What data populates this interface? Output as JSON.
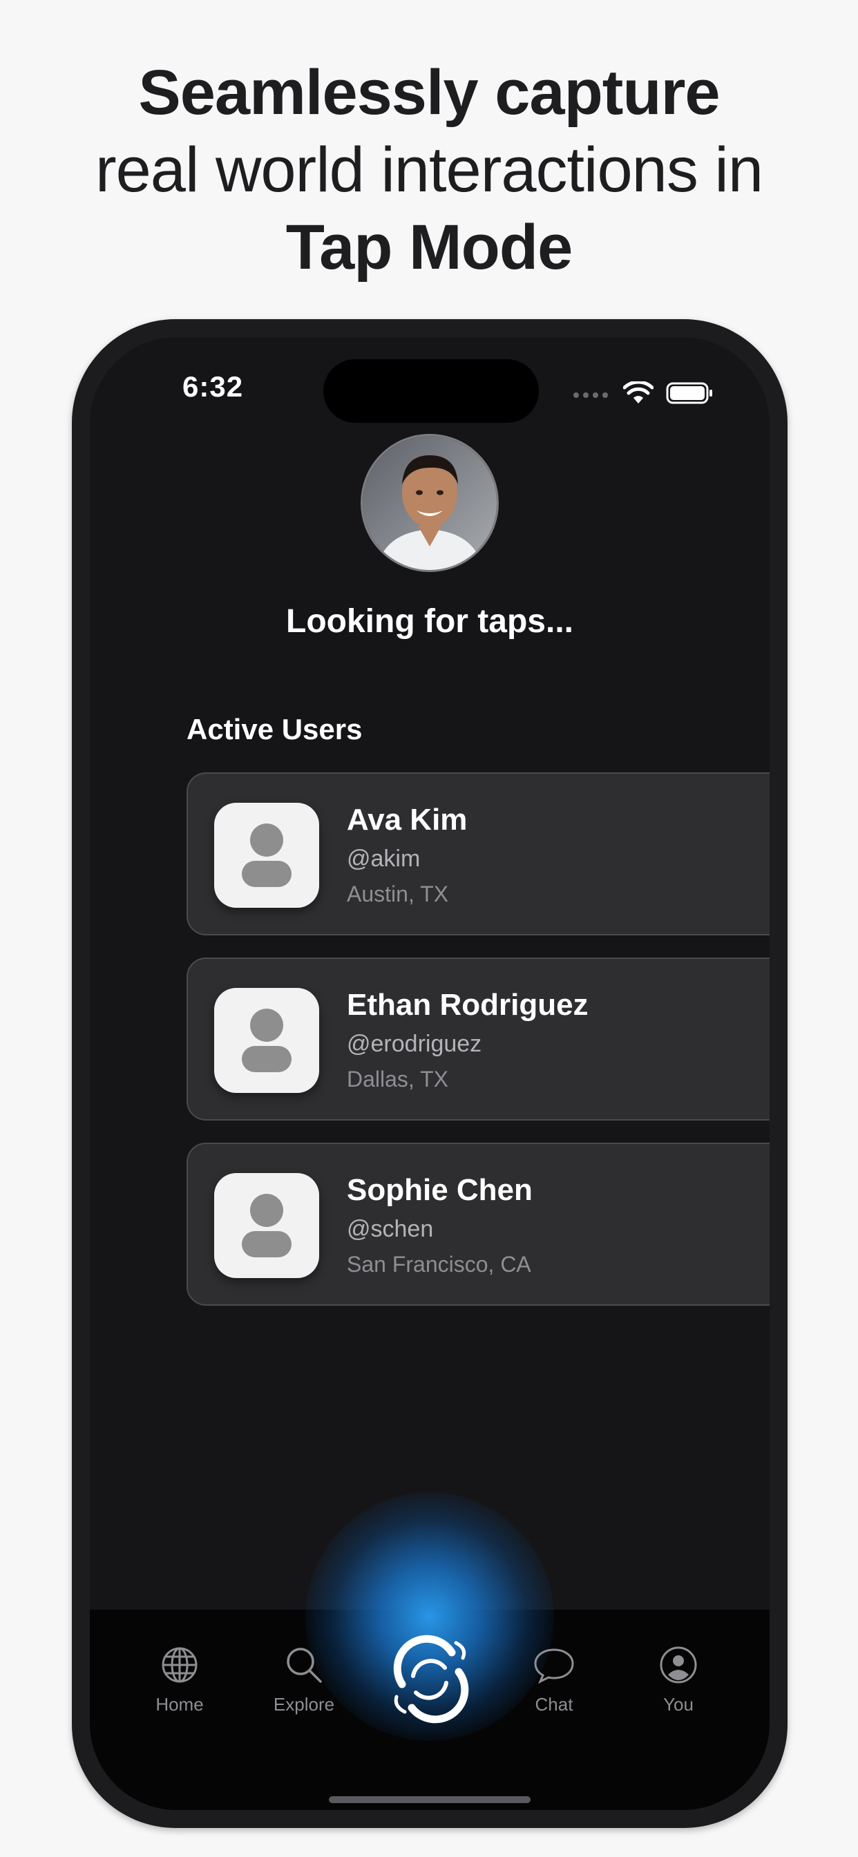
{
  "headline": {
    "line1": "Seamlessly capture",
    "line2": "real world interactions in",
    "line3": "Tap Mode"
  },
  "status_bar": {
    "time": "6:32"
  },
  "profile": {
    "status": "Looking for taps..."
  },
  "active_users": {
    "title": "Active Users",
    "users": [
      {
        "name": "Ava Kim",
        "handle": "@akim",
        "location": "Austin, TX"
      },
      {
        "name": "Ethan Rodriguez",
        "handle": "@erodriguez",
        "location": "Dallas, TX"
      },
      {
        "name": "Sophie Chen",
        "handle": "@schen",
        "location": "San Francisco, CA"
      }
    ]
  },
  "tabbar": {
    "tabs": [
      {
        "label": "Home",
        "icon": "globe-icon"
      },
      {
        "label": "Explore",
        "icon": "search-icon"
      },
      {
        "label": "",
        "icon": "swirl-logo-icon"
      },
      {
        "label": "Chat",
        "icon": "chat-bubble-icon"
      },
      {
        "label": "You",
        "icon": "person-circle-icon"
      }
    ]
  },
  "colors": {
    "background": "#f7f7f8",
    "screen": "#151517",
    "card": "#2e2e31",
    "accent_glow": "#2896e6"
  }
}
